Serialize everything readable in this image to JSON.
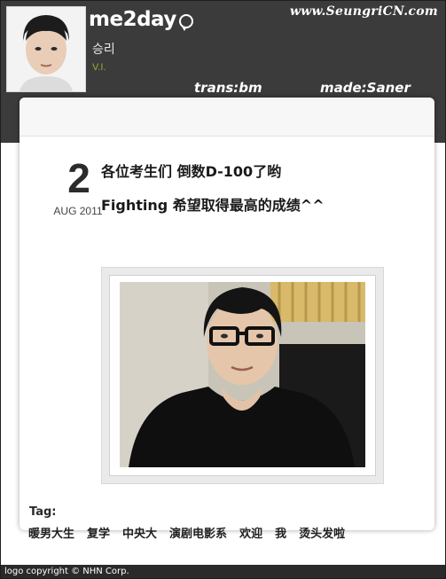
{
  "header": {
    "brand": "me2day",
    "user_name": "승리",
    "user_role": "V.I.",
    "site": "www.SeungriCN.com",
    "trans_credit": "trans:bm",
    "made_credit": "made:Saner"
  },
  "post": {
    "day": "2",
    "month_year": "AUG 2011",
    "line1": "各位考生们 倒数D-100了哟",
    "line2": "Fighting 希望取得最高的成绩^^"
  },
  "tags": {
    "label": "Tag:",
    "items": [
      "暖男大生",
      "复学",
      "中央大",
      "演剧电影系",
      "欢迎",
      "我",
      "烫头发啦"
    ]
  },
  "footer": {
    "copyright": "logo copyright © NHN Corp."
  }
}
